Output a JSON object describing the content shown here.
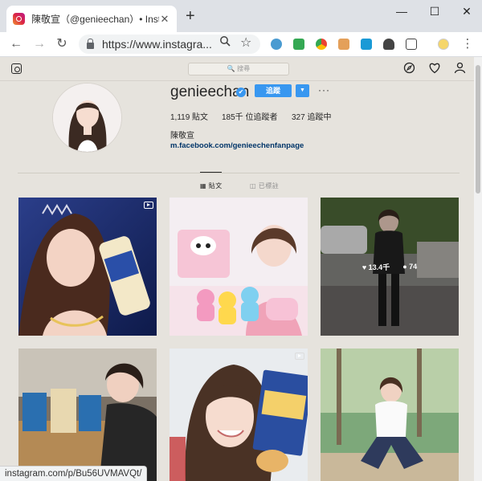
{
  "browser": {
    "tab_title": "陳敬宣（@genieechan）• Instagram",
    "tab_close": "✕",
    "new_tab": "+",
    "url": "https://www.instagra...",
    "status_url": "instagram.com/p/Bu56UVMAVQt/"
  },
  "instagram": {
    "search_placeholder": "🔍 搜尋",
    "username": "genieechan",
    "verified_mark": "✔",
    "follow_label": "追蹤",
    "dropdown_glyph": "▼",
    "more_glyph": "···",
    "stats": {
      "posts": "1,119 貼文",
      "followers": "185千 位追蹤者",
      "following": "327 追蹤中"
    },
    "full_name": "陳敬宣",
    "external_link": "m.facebook.com/genieechenfanpage",
    "tabs": [
      {
        "label": "▦ 貼文",
        "active": true
      },
      {
        "label": "◫ 已標註",
        "active": false
      }
    ],
    "hover_post": {
      "likes": "♥ 13.4千",
      "comments": "● 74"
    }
  },
  "colors": {
    "accent": "#3897f0",
    "page_bg": "#e6e3dd"
  }
}
